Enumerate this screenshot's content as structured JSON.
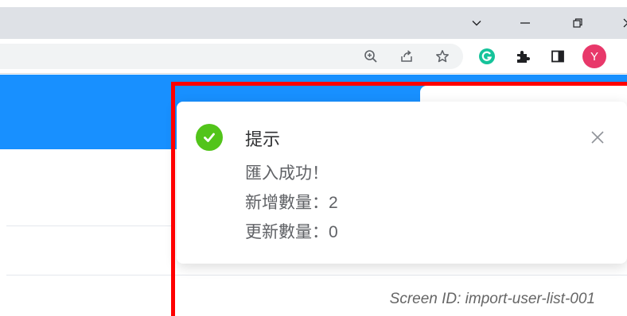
{
  "notification": {
    "title": "提示",
    "lines": [
      "匯入成功！",
      "新增數量：2",
      "更新數量：0"
    ],
    "status": "success"
  },
  "browser": {
    "profile_initial": "Y"
  },
  "footer": {
    "screen_id": "Screen ID: import-user-list-001"
  },
  "colors": {
    "accent": "#1890ff",
    "success": "#52c41a",
    "highlight": "#ff0000",
    "avatar": "#e8386a"
  },
  "icons": [
    "chevron-down-icon",
    "minimize-icon",
    "restore-icon",
    "close-window-icon",
    "zoom-icon",
    "share-icon",
    "bookmark-star-icon",
    "grammarly-icon",
    "extensions-icon",
    "side-panel-icon",
    "success-check-icon",
    "close-icon"
  ]
}
